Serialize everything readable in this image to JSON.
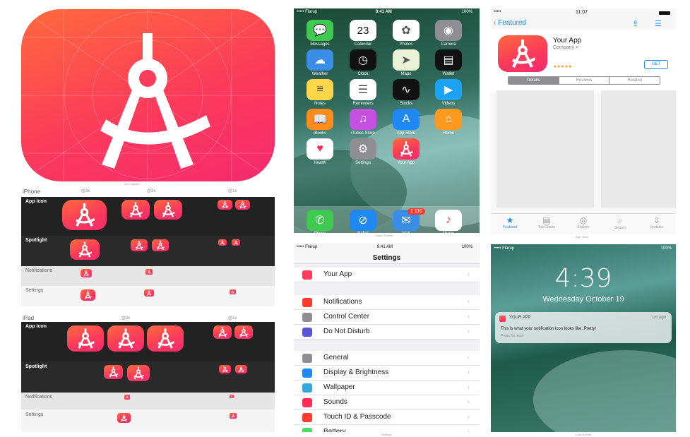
{
  "big_icon": {
    "caption": "Icon caption"
  },
  "iphone_grid": {
    "title": "iPhone",
    "col_headers": [
      "@3x",
      "@2x",
      "@1x"
    ],
    "rows": [
      {
        "label": "App Icon"
      },
      {
        "label": "Spotlight"
      },
      {
        "label": "Notifications"
      },
      {
        "label": "Settings"
      }
    ]
  },
  "ipad_grid": {
    "title": "iPad",
    "col_headers": [
      "@2x",
      "@1x"
    ],
    "rows": [
      {
        "label": "App Icon"
      },
      {
        "label": "Spotlight"
      },
      {
        "label": "Notifications"
      },
      {
        "label": "Settings"
      }
    ]
  },
  "home_screen": {
    "status": {
      "carrier": "••••• Flarup",
      "time": "9:41 AM",
      "battery": "100%"
    },
    "calendar_day": "23",
    "apps": [
      {
        "label": "Messages",
        "color": "#3fc94f",
        "glyph": "💬"
      },
      {
        "label": "Calendar",
        "color": "#ffffff",
        "glyph": ""
      },
      {
        "label": "Photos",
        "color": "#ffffff",
        "glyph": "✿"
      },
      {
        "label": "Camera",
        "color": "#8e8e93",
        "glyph": "◉"
      },
      {
        "label": "Weather",
        "color": "#3a8ee6",
        "glyph": "☁"
      },
      {
        "label": "Clock",
        "color": "#111111",
        "glyph": "◷"
      },
      {
        "label": "Maps",
        "color": "#e9f1d6",
        "glyph": "➤"
      },
      {
        "label": "Wallet",
        "color": "#111111",
        "glyph": "▤"
      },
      {
        "label": "Notes",
        "color": "#ffd54a",
        "glyph": "≡"
      },
      {
        "label": "Reminders",
        "color": "#ffffff",
        "glyph": "☰"
      },
      {
        "label": "Stocks",
        "color": "#111111",
        "glyph": "∿"
      },
      {
        "label": "Videos",
        "color": "#1da1f2",
        "glyph": "▶"
      },
      {
        "label": "iBooks",
        "color": "#ff8c1a",
        "glyph": "📖"
      },
      {
        "label": "iTunes Store",
        "color": "#c44fe0",
        "glyph": "♫"
      },
      {
        "label": "App Store",
        "color": "#1e88f5",
        "glyph": "A"
      },
      {
        "label": "Home",
        "color": "#ff9a1f",
        "glyph": "⌂"
      },
      {
        "label": "Health",
        "color": "#ffffff",
        "glyph": "♥"
      },
      {
        "label": "Settings",
        "color": "#8e8e93",
        "glyph": "⚙"
      },
      {
        "label": "Your App",
        "color": "#fb3b5a",
        "glyph": ""
      }
    ],
    "dock": [
      {
        "label": "Phone",
        "color": "#3fc94f",
        "glyph": "✆"
      },
      {
        "label": "Safari",
        "color": "#1e88f5",
        "glyph": "⊘"
      },
      {
        "label": "Mail",
        "color": "#3a8ee6",
        "glyph": "✉"
      },
      {
        "label": "Music",
        "color": "#ffffff",
        "glyph": "♪"
      }
    ],
    "mail_badge": "1 110",
    "caption": "Home Screen"
  },
  "app_store": {
    "status_time": "11:07",
    "back_label": "Featured",
    "app_name": "Your App",
    "company": "Company >",
    "stars": "★★★★★",
    "get_label": "GET",
    "segments": [
      "Details",
      "Reviews",
      "Related"
    ],
    "tabs": [
      "Featured",
      "Top Charts",
      "Explore",
      "Search",
      "Updates"
    ],
    "caption": "App Store"
  },
  "settings_screen": {
    "status": {
      "carrier": "••••• Flarup",
      "time": "9:41 AM",
      "battery": "100%"
    },
    "title": "Settings",
    "your_app": "Your App",
    "rows": [
      {
        "label": "Notifications",
        "color": "#ff3b30"
      },
      {
        "label": "Control Center",
        "color": "#8e8e93"
      },
      {
        "label": "Do Not Disturb",
        "color": "#5856d6"
      },
      {
        "label": "General",
        "color": "#8e8e93"
      },
      {
        "label": "Display & Brightness",
        "color": "#1e88f5"
      },
      {
        "label": "Wallpaper",
        "color": "#34aadc"
      },
      {
        "label": "Sounds",
        "color": "#ff2d55"
      },
      {
        "label": "Touch ID & Passcode",
        "color": "#ff3b30"
      },
      {
        "label": "Battery",
        "color": "#4cd964"
      }
    ],
    "caption": "Settings"
  },
  "lock_screen": {
    "status": {
      "carrier": "••••• Flarup",
      "battery": "100%"
    },
    "time": "4:39",
    "date": "Wednesday October 19",
    "notif_app": "YOUR APP",
    "notif_when": "1m ago",
    "notif_body": "This is what your notification icon looks like. Pretty!",
    "notif_hint": "Press for more",
    "caption": "Lock Screen"
  }
}
